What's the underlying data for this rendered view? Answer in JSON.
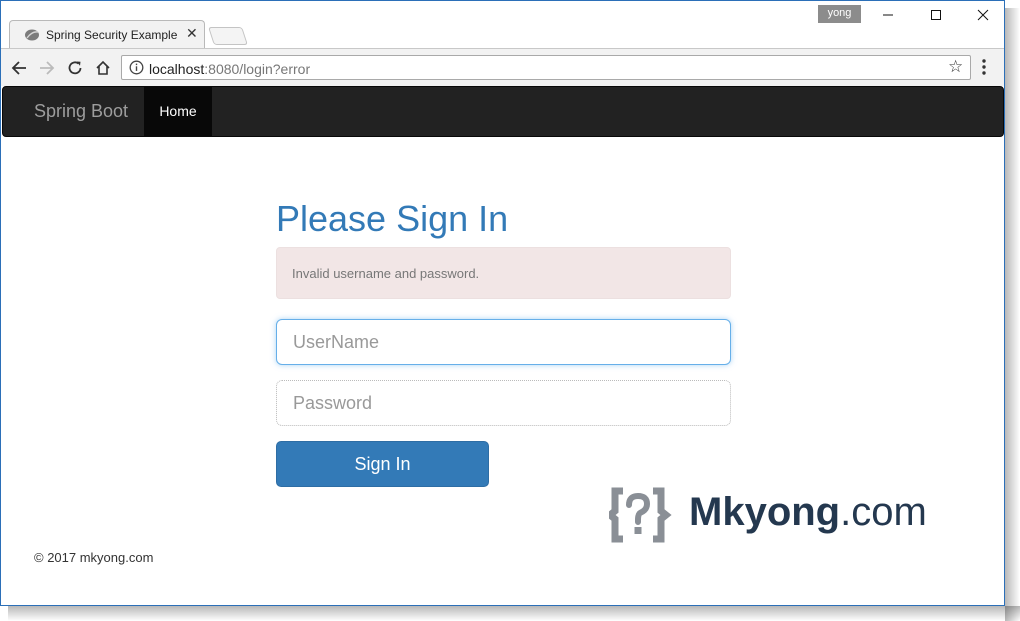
{
  "browser": {
    "tab_title": "Spring Security Example",
    "profile_name": "yong",
    "url_host": "localhost",
    "url_rest": ":8080/login?error"
  },
  "navbar": {
    "brand": "Spring Boot",
    "items": [
      {
        "label": "Home"
      }
    ]
  },
  "login": {
    "heading": "Please Sign In",
    "error_message": "Invalid username and password.",
    "username_placeholder": "UserName",
    "password_placeholder": "Password",
    "submit_label": "Sign In"
  },
  "watermark": {
    "brand": "Mkyong",
    "suffix": ".com"
  },
  "footer": {
    "text": "© 2017 mkyong.com"
  },
  "colors": {
    "primary": "#337ab7",
    "navbar": "#222222",
    "alert_bg": "#f2e6e6"
  }
}
